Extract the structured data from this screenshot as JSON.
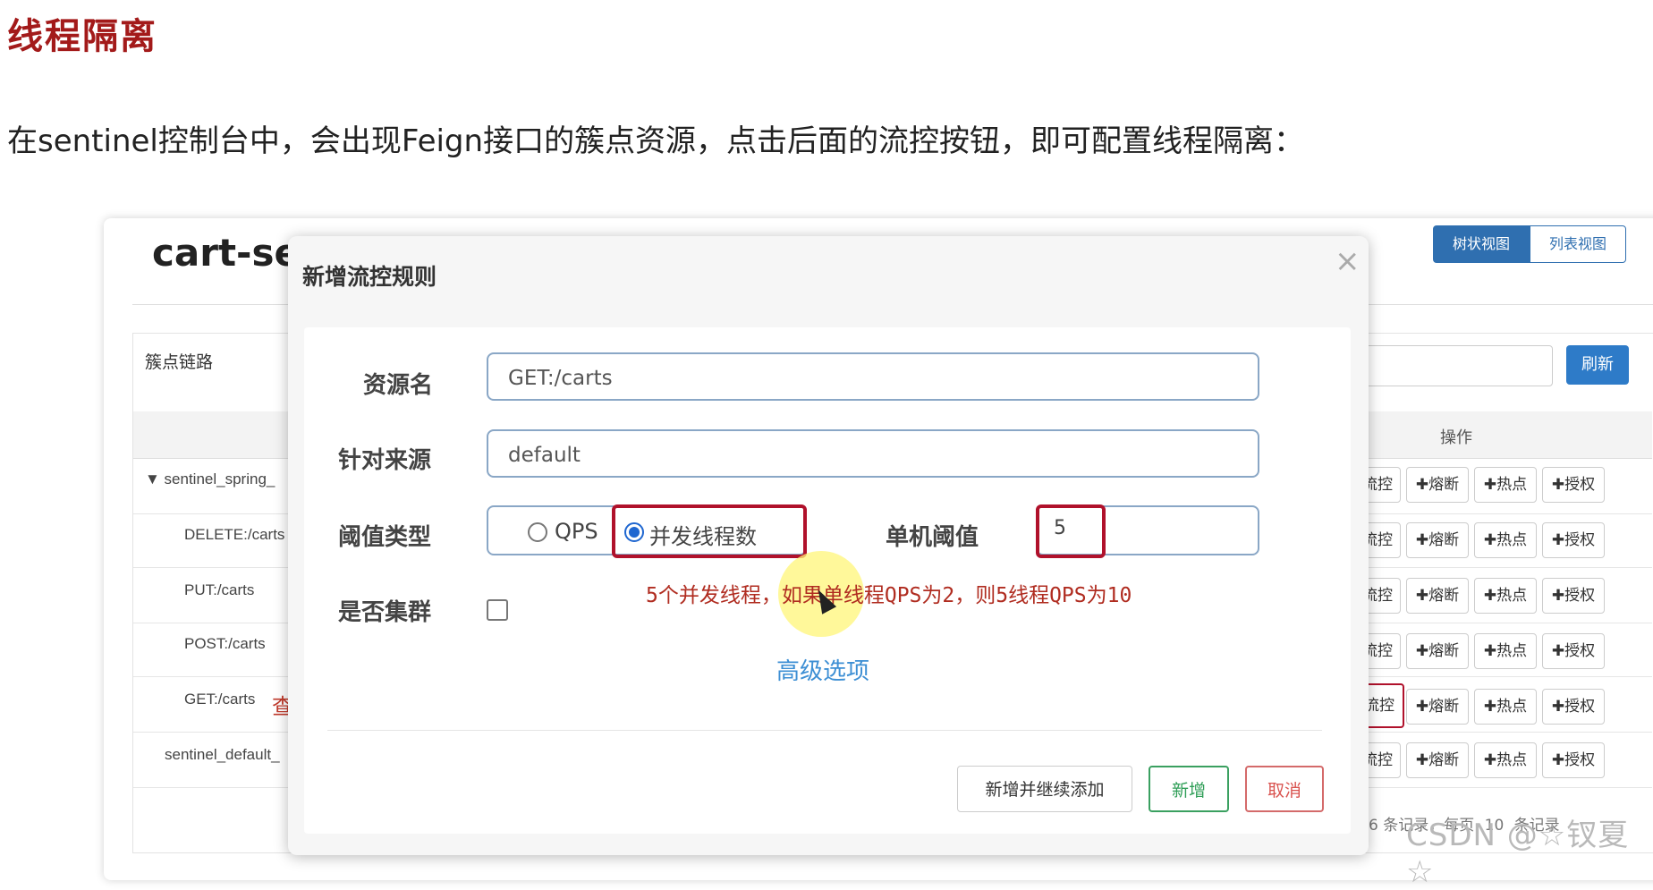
{
  "doc": {
    "title": "线程隔离",
    "paragraph": "在sentinel控制台中，会出现Feign接口的簇点资源，点击后面的流控按钮，即可配置线程隔离："
  },
  "console": {
    "app_name": "cart-se",
    "view_toggle": {
      "tree": "树状视图",
      "list": "列表视图"
    },
    "panel_title": "簇点链路",
    "refresh_label": "刷新",
    "operations_header": "操作",
    "tree_rows": [
      {
        "label": "▼ sentinel_spring_"
      },
      {
        "label": "DELETE:/carts"
      },
      {
        "label": "PUT:/carts"
      },
      {
        "label": "POST:/carts"
      },
      {
        "label": "GET:/carts"
      },
      {
        "label": "sentinel_default_"
      }
    ],
    "row_marker": "查",
    "row_ops": {
      "flow": "流控",
      "degrade": "✚熔断",
      "hotspot": "✚热点",
      "auth": "✚授权"
    },
    "pager_text": "6 条记录，每页",
    "page_size": "10",
    "pager_tail": "条记录",
    "watermark": "CSDN @☆钗夏☆"
  },
  "modal": {
    "title": "新增流控规则",
    "close_icon": "×",
    "resource_label": "资源名",
    "resource_value": "GET:/carts",
    "origin_label": "针对来源",
    "origin_value": "default",
    "threshold_type_label": "阈值类型",
    "radio_qps": "QPS",
    "radio_threads": "并发线程数",
    "single_threshold_label": "单机阈值",
    "single_threshold_value": "5",
    "cluster_label": "是否集群",
    "note": "5个并发线程，如果单线程QPS为2，则5线程QPS为10",
    "advanced_label": "高级选项",
    "buttons": {
      "add_continue": "新增并继续添加",
      "add": "新增",
      "cancel": "取消"
    }
  }
}
